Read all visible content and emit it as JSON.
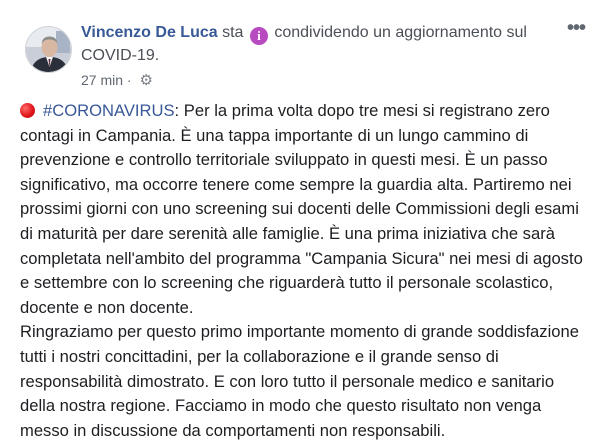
{
  "post": {
    "author": "Vincenzo De Luca",
    "action_pre": "sta",
    "action_post": "condividendo un aggiornamento sul COVID-19.",
    "time": "27 min",
    "separator": "·",
    "more_label": "•••",
    "hashtag": "#CORONAVIRUS",
    "body_after_hashtag": ": Per la prima volta dopo tre mesi si registrano zero contagi in Campania. È una tappa importante di un lungo cammino di prevenzione e controllo territoriale sviluppato in questi mesi. È un passo significativo, ma occorre tenere come sempre la guardia alta. Partiremo nei prossimi giorni con uno screening sui docenti delle Commissioni degli esami di maturità per dare serenità alle famiglie. È una prima iniziativa che sarà completata nell'ambito del programma \"Campania Sicura\" nei mesi di agosto e settembre con lo screening che riguarderà tutto il personale scolastico, docente e non docente.\nRingraziamo per questo primo importante momento di grande soddisfazione tutti i nostri concittadini, per la collaborazione e il grande senso di responsabilità dimostrato. E con loro tutto il personale medico e sanitario della nostra regione. Facciamo in modo che questo risultato non venga messo in discussione da comportamenti non responsabili."
  },
  "icons": {
    "info": "info-icon",
    "gear": "gear-icon",
    "red_circle": "red-circle-icon",
    "more": "more-icon"
  },
  "colors": {
    "link": "#385898",
    "text": "#1c1e21",
    "meta": "#616770",
    "info_badge": "#b84bbf",
    "red_circle": "#e0161b"
  }
}
